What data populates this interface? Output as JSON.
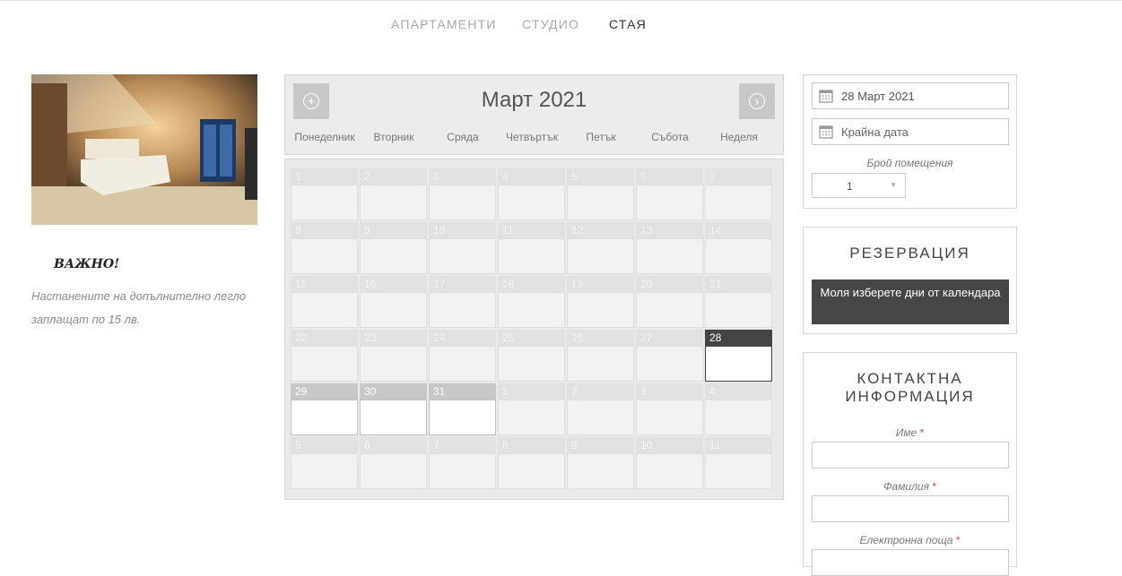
{
  "nav": [
    {
      "label": "АПАРТАМЕНТИ",
      "active": false
    },
    {
      "label": "СТУДИО",
      "active": false
    },
    {
      "label": "СТАЯ",
      "active": true
    }
  ],
  "left": {
    "important": "ВАЖНО!",
    "note": "Настанените на допълнително легло заплащат по 15 лв."
  },
  "calendar": {
    "title": "Март 2021",
    "prev_icon": "plus-circle-icon",
    "next_icon": "chevron-right-circle-icon",
    "weekdays": [
      "Понеделник",
      "Вторник",
      "Сряда",
      "Четвъртък",
      "Петък",
      "Събота",
      "Неделя"
    ],
    "weeks": [
      [
        "1",
        "2",
        "3",
        "4",
        "5",
        "6",
        "7"
      ],
      [
        "8",
        "9",
        "10",
        "11",
        "12",
        "13",
        "14"
      ],
      [
        "15",
        "16",
        "17",
        "18",
        "19",
        "20",
        "21"
      ],
      [
        "22",
        "23",
        "24",
        "25",
        "26",
        "27",
        "28"
      ],
      [
        "29",
        "30",
        "31",
        "1",
        "2",
        "3",
        "4"
      ],
      [
        "5",
        "6",
        "7",
        "8",
        "9",
        "10",
        "11"
      ]
    ],
    "selected": "28",
    "available": [
      "29",
      "30",
      "31"
    ]
  },
  "booking": {
    "start_date": "28 Март 2021",
    "end_placeholder": "Крайна дата",
    "rooms_label": "Брой помещения",
    "rooms_value": "1",
    "calendar_icon": "calendar-icon"
  },
  "reservation": {
    "title": "РЕЗЕРВАЦИЯ",
    "button": "Моля изберете дни от календара"
  },
  "contact": {
    "title": "КОНТАКТНА ИНФОРМАЦИЯ",
    "fields": [
      {
        "label": "Име",
        "required": "*"
      },
      {
        "label": "Фамилия",
        "required": "*"
      },
      {
        "label": "Електронна поща",
        "required": "*"
      }
    ]
  },
  "colors": {
    "selected_day": "#444444",
    "available_day": "#c8c8c8",
    "required_mark": "#e0463a"
  }
}
